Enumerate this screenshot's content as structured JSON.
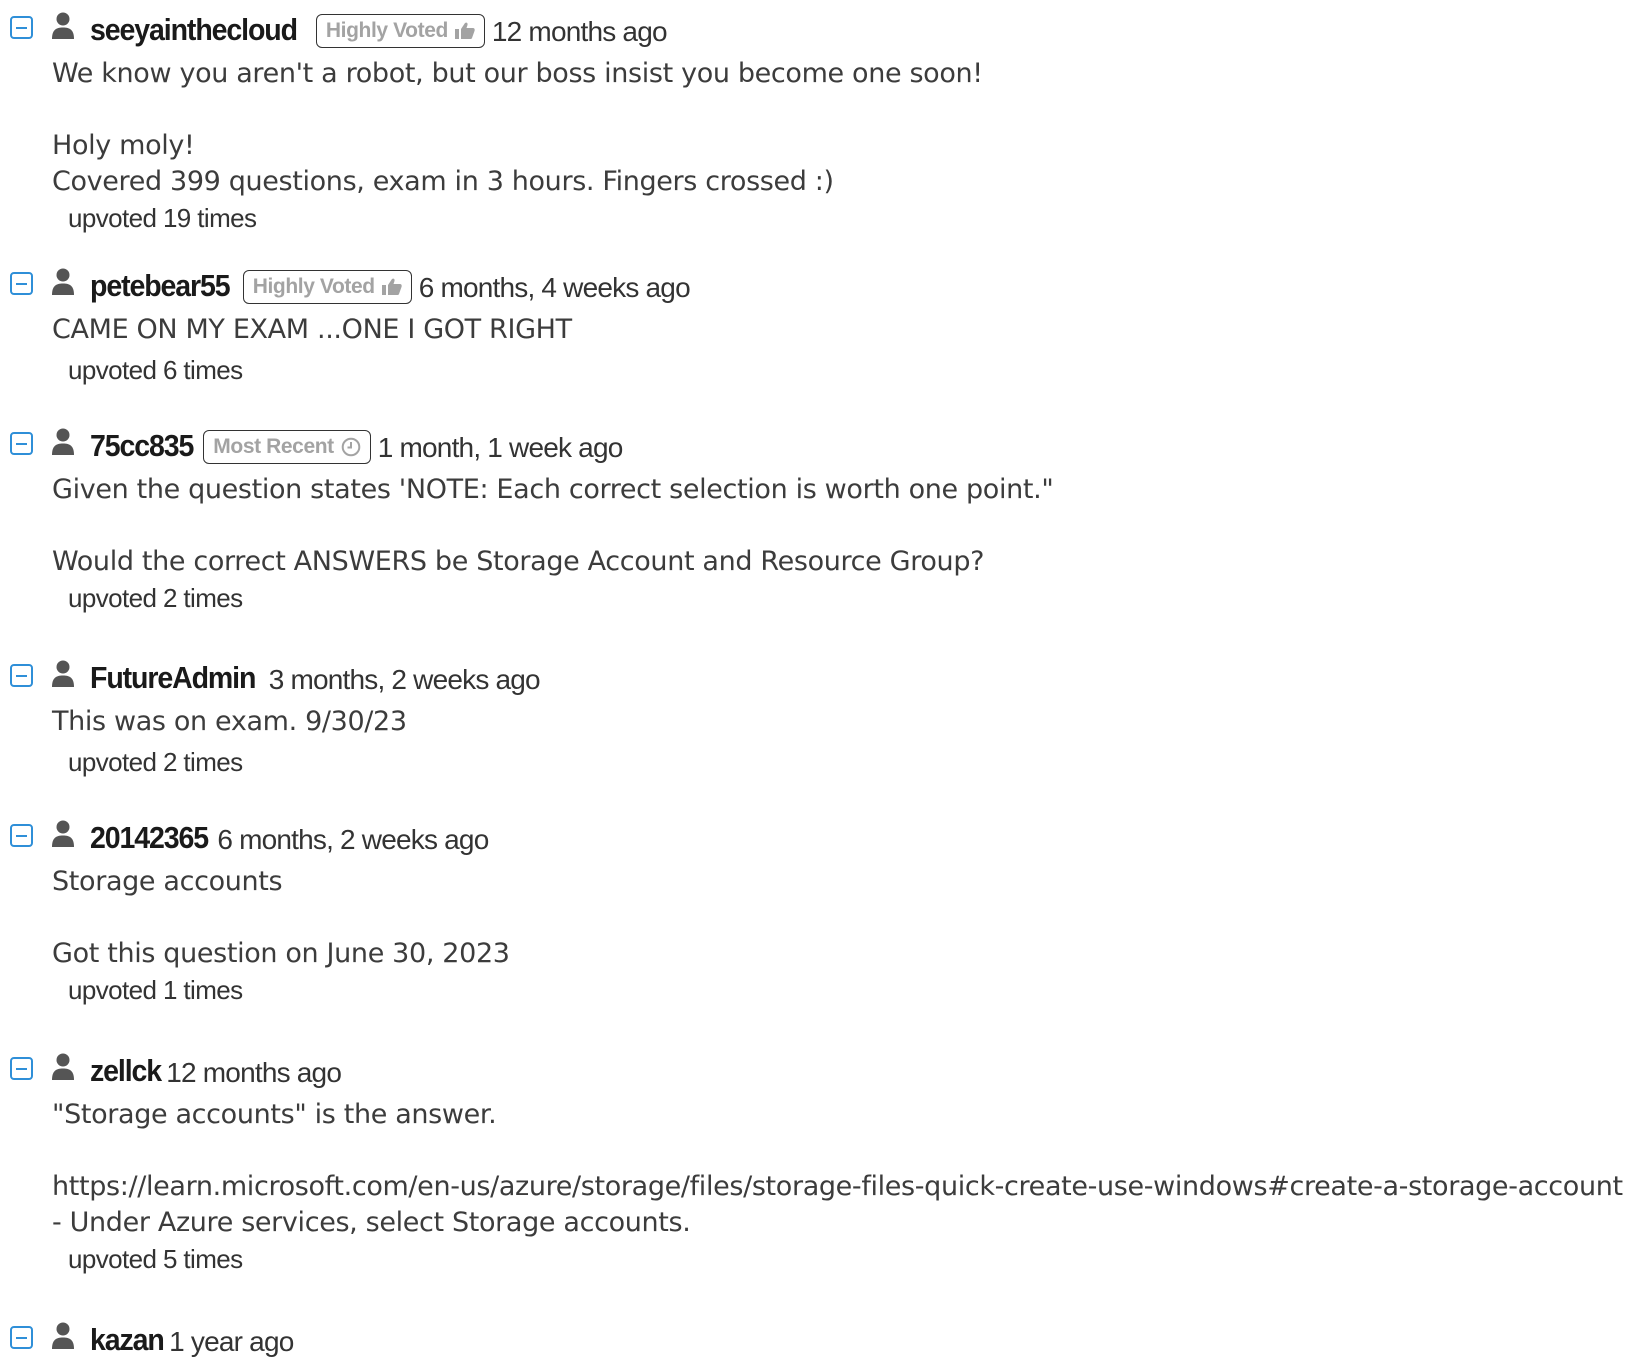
{
  "comments": [
    {
      "username": "seeyainthecloud",
      "badge": "Highly Voted",
      "badge_icon": "thumbs-up-icon",
      "timestamp": "12 months ago",
      "body": "We know you aren't a robot, but our boss insist you become one soon!\n\nHoly moly!\nCovered 399 questions, exam in 3 hours. Fingers crossed :)",
      "upvotes": "upvoted 19 times"
    },
    {
      "username": "petebear55",
      "badge": "Highly Voted",
      "badge_icon": "thumbs-up-icon",
      "timestamp": "6 months, 4 weeks ago",
      "body": "CAME ON MY EXAM ...ONE I GOT RIGHT",
      "upvotes": "upvoted 6 times"
    },
    {
      "username": "75cc835",
      "badge": "Most Recent",
      "badge_icon": "clock-icon",
      "timestamp": "1 month, 1 week ago",
      "body": "Given the question states 'NOTE: Each correct selection is worth one point.\"\n\nWould the correct ANSWERS be Storage Account and Resource Group?",
      "upvotes": "upvoted 2 times"
    },
    {
      "username": "FutureAdmin",
      "badge": "",
      "badge_icon": "",
      "timestamp": "3 months, 2 weeks ago",
      "body": "This was on exam. 9/30/23",
      "upvotes": "upvoted 2 times"
    },
    {
      "username": "20142365",
      "badge": "",
      "badge_icon": "",
      "timestamp": "6 months, 2 weeks ago",
      "body": "Storage accounts\n\nGot this question on June 30, 2023",
      "upvotes": "upvoted 1 times"
    },
    {
      "username": "zellck",
      "badge": "",
      "badge_icon": "",
      "timestamp": "12 months ago",
      "body": "\"Storage accounts\" is the answer.\n\nhttps://learn.microsoft.com/en-us/azure/storage/files/storage-files-quick-create-use-windows#create-a-storage-account\n- Under Azure services, select Storage accounts.",
      "upvotes": "upvoted 5 times"
    },
    {
      "username": "kazan",
      "badge": "",
      "badge_icon": "",
      "timestamp": "1 year ago",
      "body": "",
      "upvotes": ""
    }
  ],
  "colors": {
    "toggle_accent": "#2f8fd8",
    "username": "#1a1a1a",
    "badge_text": "#a3a3a3",
    "body_text": "#3c3c3c"
  }
}
